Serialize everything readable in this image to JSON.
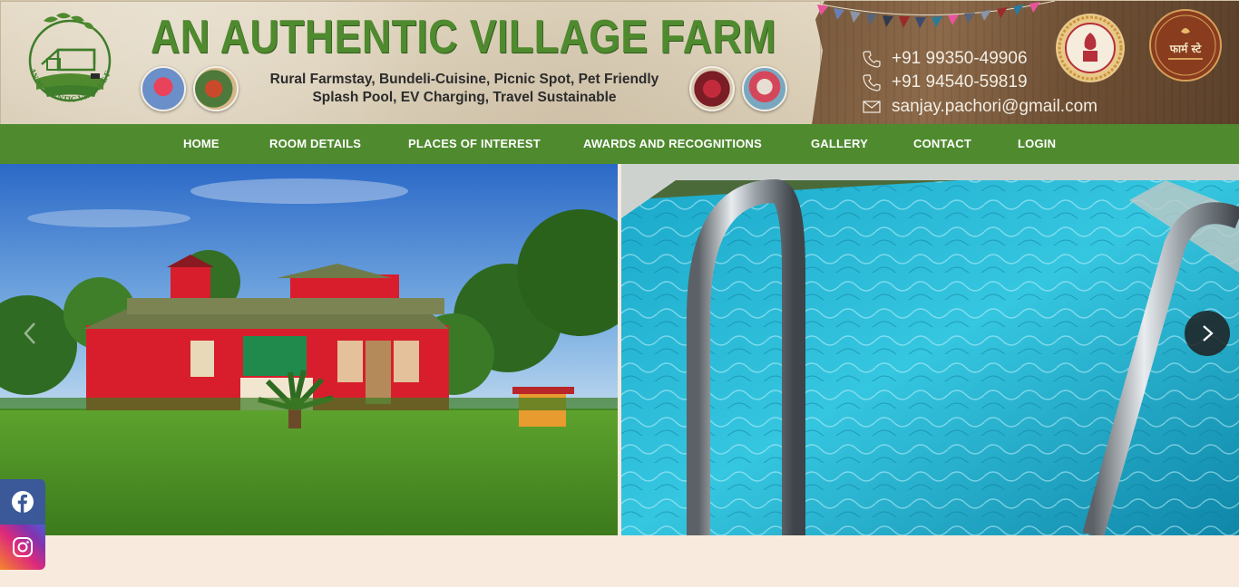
{
  "header": {
    "title": "AN AUTHENTIC VILLAGE FARM",
    "logo_text": "AN AUTHENTIC VILLAGE FARM",
    "tagline_line1": "Rural Farmstay, Bundeli-Cuisine, Picnic Spot, Pet Friendly",
    "tagline_line2": "Splash Pool, EV Charging, Travel Sustainable",
    "phone1": "+91 99350-49906",
    "phone2": "+91 94540-59819",
    "email": "sanjay.pachori@gmail.com",
    "seal2_text": "फार्म स्टे"
  },
  "nav": {
    "items": [
      {
        "label": "HOME"
      },
      {
        "label": "ROOM DETAILS"
      },
      {
        "label": "PLACES OF INTEREST"
      },
      {
        "label": "AWARDS AND RECOGNITIONS"
      },
      {
        "label": "GALLERY"
      },
      {
        "label": "CONTACT"
      },
      {
        "label": "LOGIN"
      }
    ]
  },
  "social": {
    "facebook": "facebook-icon",
    "instagram": "instagram-icon"
  },
  "colors": {
    "brand_green": "#4f8a2f",
    "page_bg": "#f8eadc",
    "facebook_blue": "#3b5998"
  }
}
